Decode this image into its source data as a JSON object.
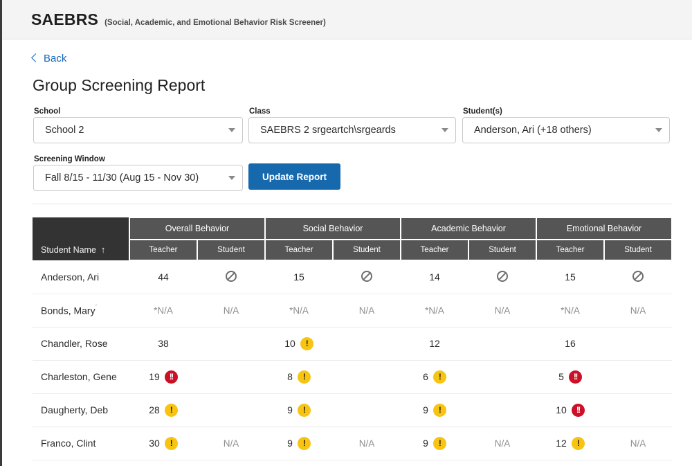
{
  "appbar": {
    "brand": "SAEBRS",
    "subtitle": "(Social, Academic, and Emotional Behavior Risk Screener)"
  },
  "nav": {
    "back_label": "Back",
    "back_icon": "chevron-left-icon"
  },
  "page": {
    "title": "Group Screening Report"
  },
  "filters": {
    "school": {
      "label": "School",
      "value": "School 2"
    },
    "class": {
      "label": "Class",
      "value": "SAEBRS 2 srgeartch\\srgeards"
    },
    "students": {
      "label": "Student(s)",
      "value": "Anderson, Ari (+18 others)"
    },
    "screening_window": {
      "label": "Screening Window",
      "value": "Fall 8/15 - 11/30 (Aug 15 - Nov 30)"
    },
    "update_button": "Update Report",
    "caret_icon": "chevron-down-icon"
  },
  "table": {
    "name_column": {
      "header": "Student Name",
      "sort_icon": "sort-ascending-arrow",
      "sort_arrow": "↑"
    },
    "groups": [
      {
        "label": "Overall Behavior",
        "sub": [
          "Teacher",
          "Student"
        ]
      },
      {
        "label": "Social Behavior",
        "sub": [
          "Teacher",
          "Student"
        ]
      },
      {
        "label": "Academic Behavior",
        "sub": [
          "Teacher",
          "Student"
        ]
      },
      {
        "label": "Emotional Behavior",
        "sub": [
          "Teacher",
          "Student"
        ]
      }
    ],
    "rows": [
      {
        "name": "Anderson, Ari",
        "name_mark": "",
        "cells": [
          {
            "text": "44",
            "flag": "none"
          },
          {
            "text": "",
            "flag": "noentry"
          },
          {
            "text": "15",
            "flag": "none"
          },
          {
            "text": "",
            "flag": "noentry"
          },
          {
            "text": "14",
            "flag": "none"
          },
          {
            "text": "",
            "flag": "noentry"
          },
          {
            "text": "15",
            "flag": "none"
          },
          {
            "text": "",
            "flag": "noentry"
          }
        ]
      },
      {
        "name": "Bonds, Mary",
        "name_mark": "˙",
        "cells": [
          {
            "text": "*N/A",
            "flag": "none",
            "muted": true
          },
          {
            "text": "N/A",
            "flag": "none",
            "muted": true
          },
          {
            "text": "*N/A",
            "flag": "none",
            "muted": true
          },
          {
            "text": "N/A",
            "flag": "none",
            "muted": true
          },
          {
            "text": "*N/A",
            "flag": "none",
            "muted": true
          },
          {
            "text": "N/A",
            "flag": "none",
            "muted": true
          },
          {
            "text": "*N/A",
            "flag": "none",
            "muted": true
          },
          {
            "text": "N/A",
            "flag": "none",
            "muted": true
          }
        ]
      },
      {
        "name": "Chandler, Rose",
        "name_mark": "",
        "cells": [
          {
            "text": "38",
            "flag": "none"
          },
          {
            "text": "",
            "flag": "none"
          },
          {
            "text": "10",
            "flag": "yellow"
          },
          {
            "text": "",
            "flag": "none"
          },
          {
            "text": "12",
            "flag": "none"
          },
          {
            "text": "",
            "flag": "none"
          },
          {
            "text": "16",
            "flag": "none"
          },
          {
            "text": "",
            "flag": "none"
          }
        ]
      },
      {
        "name": "Charleston, Gene",
        "name_mark": "",
        "cells": [
          {
            "text": "19",
            "flag": "red"
          },
          {
            "text": "",
            "flag": "none"
          },
          {
            "text": "8",
            "flag": "yellow"
          },
          {
            "text": "",
            "flag": "none"
          },
          {
            "text": "6",
            "flag": "yellow"
          },
          {
            "text": "",
            "flag": "none"
          },
          {
            "text": "5",
            "flag": "red"
          },
          {
            "text": "",
            "flag": "none"
          }
        ]
      },
      {
        "name": "Daugherty, Deb",
        "name_mark": "",
        "cells": [
          {
            "text": "28",
            "flag": "yellow"
          },
          {
            "text": "",
            "flag": "none"
          },
          {
            "text": "9",
            "flag": "yellow"
          },
          {
            "text": "",
            "flag": "none"
          },
          {
            "text": "9",
            "flag": "yellow"
          },
          {
            "text": "",
            "flag": "none"
          },
          {
            "text": "10",
            "flag": "red"
          },
          {
            "text": "",
            "flag": "none"
          }
        ]
      },
      {
        "name": "Franco, Clint",
        "name_mark": "",
        "cells": [
          {
            "text": "30",
            "flag": "yellow"
          },
          {
            "text": "N/A",
            "flag": "none",
            "muted": true
          },
          {
            "text": "9",
            "flag": "yellow"
          },
          {
            "text": "N/A",
            "flag": "none",
            "muted": true
          },
          {
            "text": "9",
            "flag": "yellow"
          },
          {
            "text": "N/A",
            "flag": "none",
            "muted": true
          },
          {
            "text": "12",
            "flag": "yellow"
          },
          {
            "text": "N/A",
            "flag": "none",
            "muted": true
          }
        ]
      }
    ]
  },
  "badges": {
    "yellow_glyph": "!",
    "red_glyph": "!!",
    "noentry_icon": "no-entry-icon"
  },
  "colors": {
    "accent": "#1769ae",
    "link": "#1466b8",
    "header_dark": "#333333",
    "header_gray": "#555555",
    "badge_yellow": "#f7c413",
    "badge_red": "#ca1127"
  }
}
